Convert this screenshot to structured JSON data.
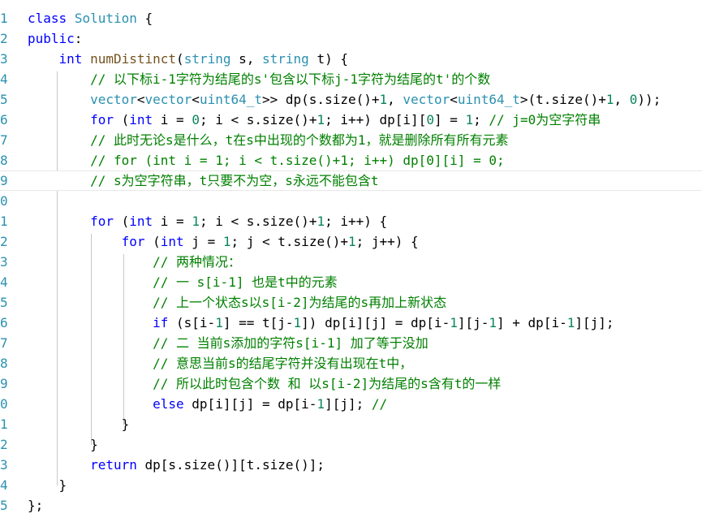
{
  "editor": {
    "lines": [
      {
        "num": "1",
        "tokens": [
          {
            "c": "k",
            "t": "class"
          },
          {
            "c": "p",
            "t": " "
          },
          {
            "c": "t",
            "t": "Solution"
          },
          {
            "c": "p",
            "t": " {"
          }
        ]
      },
      {
        "num": "2",
        "tokens": [
          {
            "c": "k",
            "t": "public"
          },
          {
            "c": "p",
            "t": ":"
          }
        ]
      },
      {
        "num": "3",
        "tokens": [
          {
            "c": "p",
            "t": "    "
          },
          {
            "c": "k",
            "t": "int"
          },
          {
            "c": "p",
            "t": " "
          },
          {
            "c": "f",
            "t": "numDistinct"
          },
          {
            "c": "p",
            "t": "("
          },
          {
            "c": "t",
            "t": "string"
          },
          {
            "c": "p",
            "t": " s, "
          },
          {
            "c": "t",
            "t": "string"
          },
          {
            "c": "p",
            "t": " t) "
          },
          {
            "c": "p",
            "t": "{"
          }
        ]
      },
      {
        "num": "4",
        "tokens": [
          {
            "c": "p",
            "t": "        "
          },
          {
            "c": "c",
            "t": "// 以下标i-1字符为结尾的s'包含以下标j-1字符为结尾的t'的个数"
          }
        ]
      },
      {
        "num": "5",
        "tokens": [
          {
            "c": "p",
            "t": "        "
          },
          {
            "c": "t",
            "t": "vector"
          },
          {
            "c": "p",
            "t": "<"
          },
          {
            "c": "t",
            "t": "vector"
          },
          {
            "c": "p",
            "t": "<"
          },
          {
            "c": "t",
            "t": "uint64_t"
          },
          {
            "c": "p",
            "t": ">> dp(s.size()+"
          },
          {
            "c": "n",
            "t": "1"
          },
          {
            "c": "p",
            "t": ", "
          },
          {
            "c": "t",
            "t": "vector"
          },
          {
            "c": "p",
            "t": "<"
          },
          {
            "c": "t",
            "t": "uint64_t"
          },
          {
            "c": "p",
            "t": ">(t.size()+"
          },
          {
            "c": "n",
            "t": "1"
          },
          {
            "c": "p",
            "t": ", "
          },
          {
            "c": "n",
            "t": "0"
          },
          {
            "c": "p",
            "t": "));"
          }
        ]
      },
      {
        "num": "6",
        "tokens": [
          {
            "c": "p",
            "t": "        "
          },
          {
            "c": "k",
            "t": "for"
          },
          {
            "c": "p",
            "t": " ("
          },
          {
            "c": "k",
            "t": "int"
          },
          {
            "c": "p",
            "t": " i = "
          },
          {
            "c": "n",
            "t": "0"
          },
          {
            "c": "p",
            "t": "; i < s.size()+"
          },
          {
            "c": "n",
            "t": "1"
          },
          {
            "c": "p",
            "t": "; i++) dp[i]["
          },
          {
            "c": "n",
            "t": "0"
          },
          {
            "c": "p",
            "t": "] = "
          },
          {
            "c": "n",
            "t": "1"
          },
          {
            "c": "p",
            "t": "; "
          },
          {
            "c": "c",
            "t": "// j=0为空字符串"
          }
        ]
      },
      {
        "num": "7",
        "tokens": [
          {
            "c": "p",
            "t": "        "
          },
          {
            "c": "c",
            "t": "// 此时无论s是什么，t在s中出现的个数都为1，就是删除所有所有元素"
          }
        ]
      },
      {
        "num": "8",
        "tokens": [
          {
            "c": "p",
            "t": "        "
          },
          {
            "c": "c",
            "t": "// for (int i = 1; i < t.size()+1; i++) dp[0][i] = 0;"
          }
        ]
      },
      {
        "num": "9",
        "tokens": [
          {
            "c": "p",
            "t": "        "
          },
          {
            "c": "c",
            "t": "// s为空字符串，t只要不为空，s永远不能包含t"
          }
        ]
      },
      {
        "num": "0",
        "tokens": []
      },
      {
        "num": "1",
        "tokens": [
          {
            "c": "p",
            "t": "        "
          },
          {
            "c": "k",
            "t": "for"
          },
          {
            "c": "p",
            "t": " ("
          },
          {
            "c": "k",
            "t": "int"
          },
          {
            "c": "p",
            "t": " i = "
          },
          {
            "c": "n",
            "t": "1"
          },
          {
            "c": "p",
            "t": "; i < s.size()+"
          },
          {
            "c": "n",
            "t": "1"
          },
          {
            "c": "p",
            "t": "; i++) {"
          }
        ]
      },
      {
        "num": "2",
        "tokens": [
          {
            "c": "p",
            "t": "            "
          },
          {
            "c": "k",
            "t": "for"
          },
          {
            "c": "p",
            "t": " ("
          },
          {
            "c": "k",
            "t": "int"
          },
          {
            "c": "p",
            "t": " j = "
          },
          {
            "c": "n",
            "t": "1"
          },
          {
            "c": "p",
            "t": "; j < t.size()+"
          },
          {
            "c": "n",
            "t": "1"
          },
          {
            "c": "p",
            "t": "; j++) {"
          }
        ]
      },
      {
        "num": "3",
        "tokens": [
          {
            "c": "p",
            "t": "                "
          },
          {
            "c": "c",
            "t": "// 两种情况："
          }
        ]
      },
      {
        "num": "4",
        "tokens": [
          {
            "c": "p",
            "t": "                "
          },
          {
            "c": "c",
            "t": "// 一 s[i-1] 也是t中的元素"
          }
        ]
      },
      {
        "num": "5",
        "tokens": [
          {
            "c": "p",
            "t": "                "
          },
          {
            "c": "c",
            "t": "// 上一个状态s以s[i-2]为结尾的s再加上新状态"
          }
        ]
      },
      {
        "num": "6",
        "tokens": [
          {
            "c": "p",
            "t": "                "
          },
          {
            "c": "k",
            "t": "if"
          },
          {
            "c": "p",
            "t": " (s[i-"
          },
          {
            "c": "n",
            "t": "1"
          },
          {
            "c": "p",
            "t": "] == t[j-"
          },
          {
            "c": "n",
            "t": "1"
          },
          {
            "c": "p",
            "t": "]) dp[i][j] = dp[i-"
          },
          {
            "c": "n",
            "t": "1"
          },
          {
            "c": "p",
            "t": "][j-"
          },
          {
            "c": "n",
            "t": "1"
          },
          {
            "c": "p",
            "t": "] + dp[i-"
          },
          {
            "c": "n",
            "t": "1"
          },
          {
            "c": "p",
            "t": "][j];"
          }
        ]
      },
      {
        "num": "7",
        "tokens": [
          {
            "c": "p",
            "t": "                "
          },
          {
            "c": "c",
            "t": "// 二 当前s添加的字符s[i-1] 加了等于没加"
          }
        ]
      },
      {
        "num": "8",
        "tokens": [
          {
            "c": "p",
            "t": "                "
          },
          {
            "c": "c",
            "t": "// 意思当前s的结尾字符并没有出现在t中，"
          }
        ]
      },
      {
        "num": "9",
        "tokens": [
          {
            "c": "p",
            "t": "                "
          },
          {
            "c": "c",
            "t": "// 所以此时包含个数 和 以s[i-2]为结尾的s含有t的一样"
          }
        ]
      },
      {
        "num": "0",
        "tokens": [
          {
            "c": "p",
            "t": "                "
          },
          {
            "c": "k",
            "t": "else"
          },
          {
            "c": "p",
            "t": " dp[i][j] = dp[i-"
          },
          {
            "c": "n",
            "t": "1"
          },
          {
            "c": "p",
            "t": "][j]; "
          },
          {
            "c": "c",
            "t": "//"
          }
        ]
      },
      {
        "num": "1",
        "tokens": [
          {
            "c": "p",
            "t": "            }"
          }
        ]
      },
      {
        "num": "2",
        "tokens": [
          {
            "c": "p",
            "t": "        }"
          }
        ]
      },
      {
        "num": "3",
        "tokens": [
          {
            "c": "p",
            "t": "        "
          },
          {
            "c": "k",
            "t": "return"
          },
          {
            "c": "p",
            "t": " dp[s.size()][t.size()];"
          }
        ]
      },
      {
        "num": "4",
        "tokens": [
          {
            "c": "p",
            "t": "    "
          },
          {
            "c": "p",
            "t": "}"
          }
        ]
      },
      {
        "num": "5",
        "tokens": [
          {
            "c": "p",
            "t": "};"
          }
        ]
      }
    ]
  }
}
